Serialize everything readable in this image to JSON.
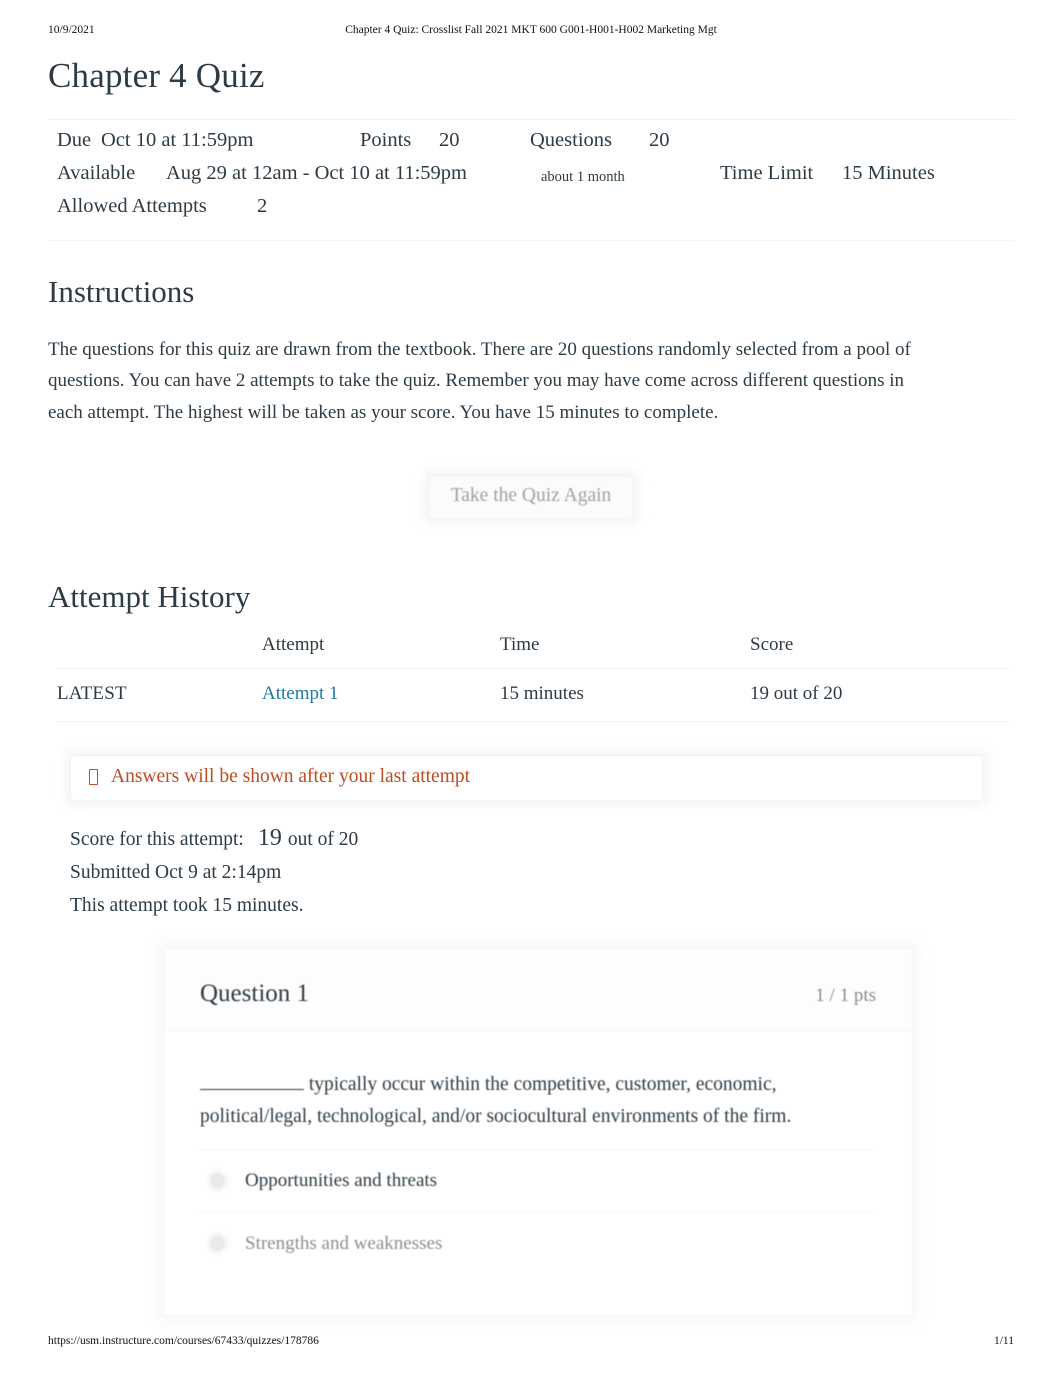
{
  "print_header": {
    "date": "10/9/2021",
    "title": "Chapter 4 Quiz: Crosslist Fall 2021 MKT 600 G001-H001-H002 Marketing Mgt"
  },
  "print_footer": {
    "url": "https://usm.instructure.com/courses/67433/quizzes/178786",
    "page": "1/11"
  },
  "quiz": {
    "title": "Chapter 4 Quiz",
    "details": {
      "due_label": "Due",
      "due_value": "Oct 10 at 11:59pm",
      "points_label": "Points",
      "points_value": "20",
      "questions_label": "Questions",
      "questions_value": "20",
      "available_label": "Available",
      "available_value": "Aug 29 at 12am - Oct 10 at 11:59pm",
      "available_duration": "about 1 month",
      "time_limit_label": "Time Limit",
      "time_limit_value": "15 Minutes",
      "allowed_attempts_label": "Allowed Attempts",
      "allowed_attempts_value": "2"
    }
  },
  "instructions": {
    "heading": "Instructions",
    "body": "The questions for this quiz are drawn from the textbook. There are 20 questions randomly selected from a pool of questions. You can have 2 attempts to take the quiz. Remember you may have come across different questions in each attempt. The highest will be taken as your score. You have 15 minutes to complete."
  },
  "actions": {
    "take_quiz_again": "Take the Quiz Again"
  },
  "attempt_history": {
    "heading": "Attempt History",
    "columns": {
      "kept": "",
      "attempt": "Attempt",
      "time": "Time",
      "score": "Score"
    },
    "rows": [
      {
        "kept": "LATEST",
        "attempt": "Attempt 1",
        "time": "15 minutes",
        "score": "19 out of 20"
      }
    ]
  },
  "answers_notice": {
    "icon": "warning-box-icon",
    "text": "Answers will be shown after your last attempt",
    "color": "#bf4b22"
  },
  "attempt_summary": {
    "score_label": "Score for this attempt:",
    "score_value": "19",
    "score_out_of": "out of 20",
    "submitted": "Submitted Oct 9 at 2:14pm",
    "duration": "This attempt took 15 minutes."
  },
  "questions": [
    {
      "title": "Question 1",
      "points": "1 / 1 pts",
      "text_before_blank": "",
      "text_after_blank": " typically occur within the competitive, customer, economic, political/legal, technological, and/or sociocultural environments of the firm.",
      "options": [
        {
          "label": "Opportunities and threats",
          "dim": false
        },
        {
          "label": "Strengths and weaknesses",
          "dim": true
        }
      ]
    }
  ],
  "colors": {
    "link": "#1c7ca6",
    "text": "#2d3b45",
    "notice": "#bf4b22",
    "muted": "#8b8b8b"
  }
}
